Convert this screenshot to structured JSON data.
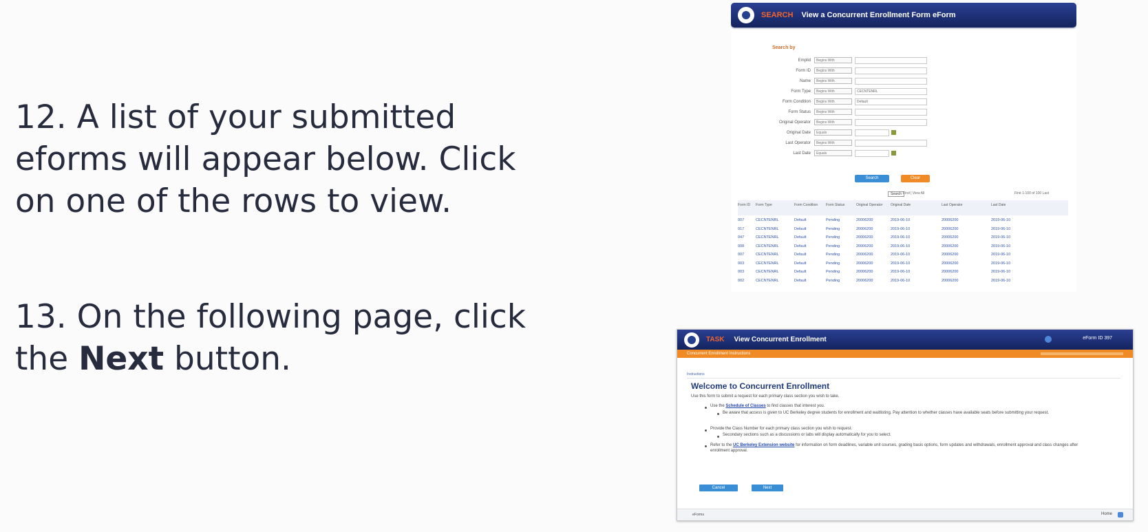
{
  "steps": {
    "s12": "12. A list of your submitted eforms will appear below. Click on one of the rows to view.",
    "s13_pre": "13. On the following page, click the ",
    "s13_bold": "Next",
    "s13_post": " button."
  },
  "search_screen": {
    "tag": "SEARCH",
    "title": "View a Concurrent Enrollment Form eForm",
    "section_label": "Search by",
    "fields": [
      {
        "label": "Emplid",
        "op": "Begins With",
        "value": ""
      },
      {
        "label": "Form ID",
        "op": "Begins With",
        "value": ""
      },
      {
        "label": "Name",
        "op": "Begins With",
        "value": ""
      },
      {
        "label": "Form Type",
        "op": "Begins With",
        "value": "CECNTENRL"
      },
      {
        "label": "Form Condition",
        "op": "Begins With",
        "value": "Default"
      },
      {
        "label": "Form Status",
        "op": "Begins With",
        "value": ""
      },
      {
        "label": "Original Operator",
        "op": "Begins With",
        "value": ""
      },
      {
        "label": "Original Date",
        "op": "Equals",
        "value": ""
      },
      {
        "label": "Last Operator",
        "op": "Begins With",
        "value": ""
      },
      {
        "label": "Last Date",
        "op": "Equals",
        "value": ""
      }
    ],
    "search_btn": "Search",
    "clear_btn": "Clear",
    "tooltip": "Search",
    "pager_left": "Find | View All",
    "pager_right": "First  1-100 of 100  Last",
    "columns": [
      "Form ID",
      "Form Type",
      "Form Condition",
      "Form Status",
      "Original Operator",
      "Original Date",
      "Last Operator",
      "Last Date"
    ],
    "rows": [
      [
        "007",
        "CECNTENRL",
        "Default",
        "Pending",
        "20006200",
        "2019-06-10",
        "20006200",
        "2019-06-10"
      ],
      [
        "017",
        "CECNTENRL",
        "Default",
        "Pending",
        "20006200",
        "2019-06-10",
        "20006200",
        "2019-06-10"
      ],
      [
        "047",
        "CECNTENRL",
        "Default",
        "Pending",
        "20006200",
        "2019-06-10",
        "20006200",
        "2019-06-10"
      ],
      [
        "008",
        "CECNTENRL",
        "Default",
        "Pending",
        "20006200",
        "2019-06-10",
        "20006200",
        "2019-06-10"
      ],
      [
        "007",
        "CECNTENRL",
        "Default",
        "Pending",
        "20006200",
        "2019-06-10",
        "20006200",
        "2019-06-10"
      ],
      [
        "003",
        "CECNTENRL",
        "Default",
        "Pending",
        "20006200",
        "2019-06-10",
        "20006200",
        "2019-06-10"
      ],
      [
        "003",
        "CECNTENRL",
        "Default",
        "Pending",
        "20006200",
        "2019-06-10",
        "20006200",
        "2019-06-10"
      ],
      [
        "002",
        "CECNTENRL",
        "Default",
        "Pending",
        "20006200",
        "2019-06-10",
        "20006200",
        "2019-06-10"
      ]
    ]
  },
  "view_screen": {
    "tag": "TASK",
    "title": "View Concurrent Enrollment",
    "eform_id": "eForm ID 397",
    "subbar": "Concurrent Enrollment Instructions",
    "crumb": "Instructions",
    "heading": "Welcome to Concurrent Enrollment",
    "intro": "Use this form to submit a request for each primary class section you wish to take.",
    "b1_pre": "Use the ",
    "b1_link": "Schedule of Classes",
    "b1_post": " to find classes that interest you.",
    "b1_sub": "Be aware that access is given to UC Berkeley degree students for enrollment and waitlisting. Pay attention to whether classes have available seats before submitting your request.",
    "b2": "Provide the Class Number for each primary class section you wish to request.",
    "b2_sub": "Secondary sections such as a discussions or labs will display automatically for you to select.",
    "b3_pre": "Refer to the ",
    "b3_link": "UC Berkeley Extension website",
    "b3_post": " for information on form deadlines, variable unit courses, grading basis options, form updates and withdrawals, enrollment approval and class changes after enrollment approval.",
    "cancel_btn": "Cancel",
    "next_btn": "Next",
    "footer_left": "eForms",
    "footer_right": "Home"
  }
}
